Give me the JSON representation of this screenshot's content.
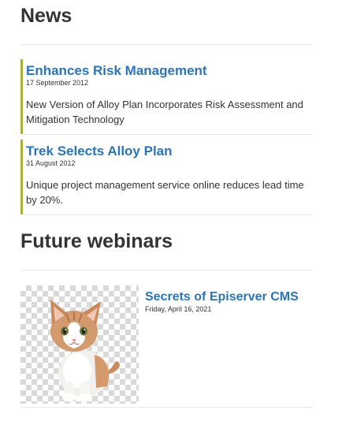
{
  "news": {
    "title": "News",
    "items": [
      {
        "headline": "Enhances Risk Management",
        "date": "17 September 2012",
        "summary": "New Version of Alloy Plan Incorporates Risk Assessment and Mitigation Technology"
      },
      {
        "headline": "Trek Selects Alloy Plan",
        "date": "31 August 2012",
        "summary": "Unique project management service online reduces lead time by 20%."
      }
    ]
  },
  "webinars": {
    "title": "Future webinars",
    "items": [
      {
        "title": "Secrets of Episerver CMS",
        "date": "Friday, April 16, 2021",
        "image": "kitten-photo"
      }
    ]
  },
  "colors": {
    "link": "#2a74b8",
    "accent_border": "#a4b338",
    "text": "#333333",
    "divider": "#e8e8e8"
  }
}
